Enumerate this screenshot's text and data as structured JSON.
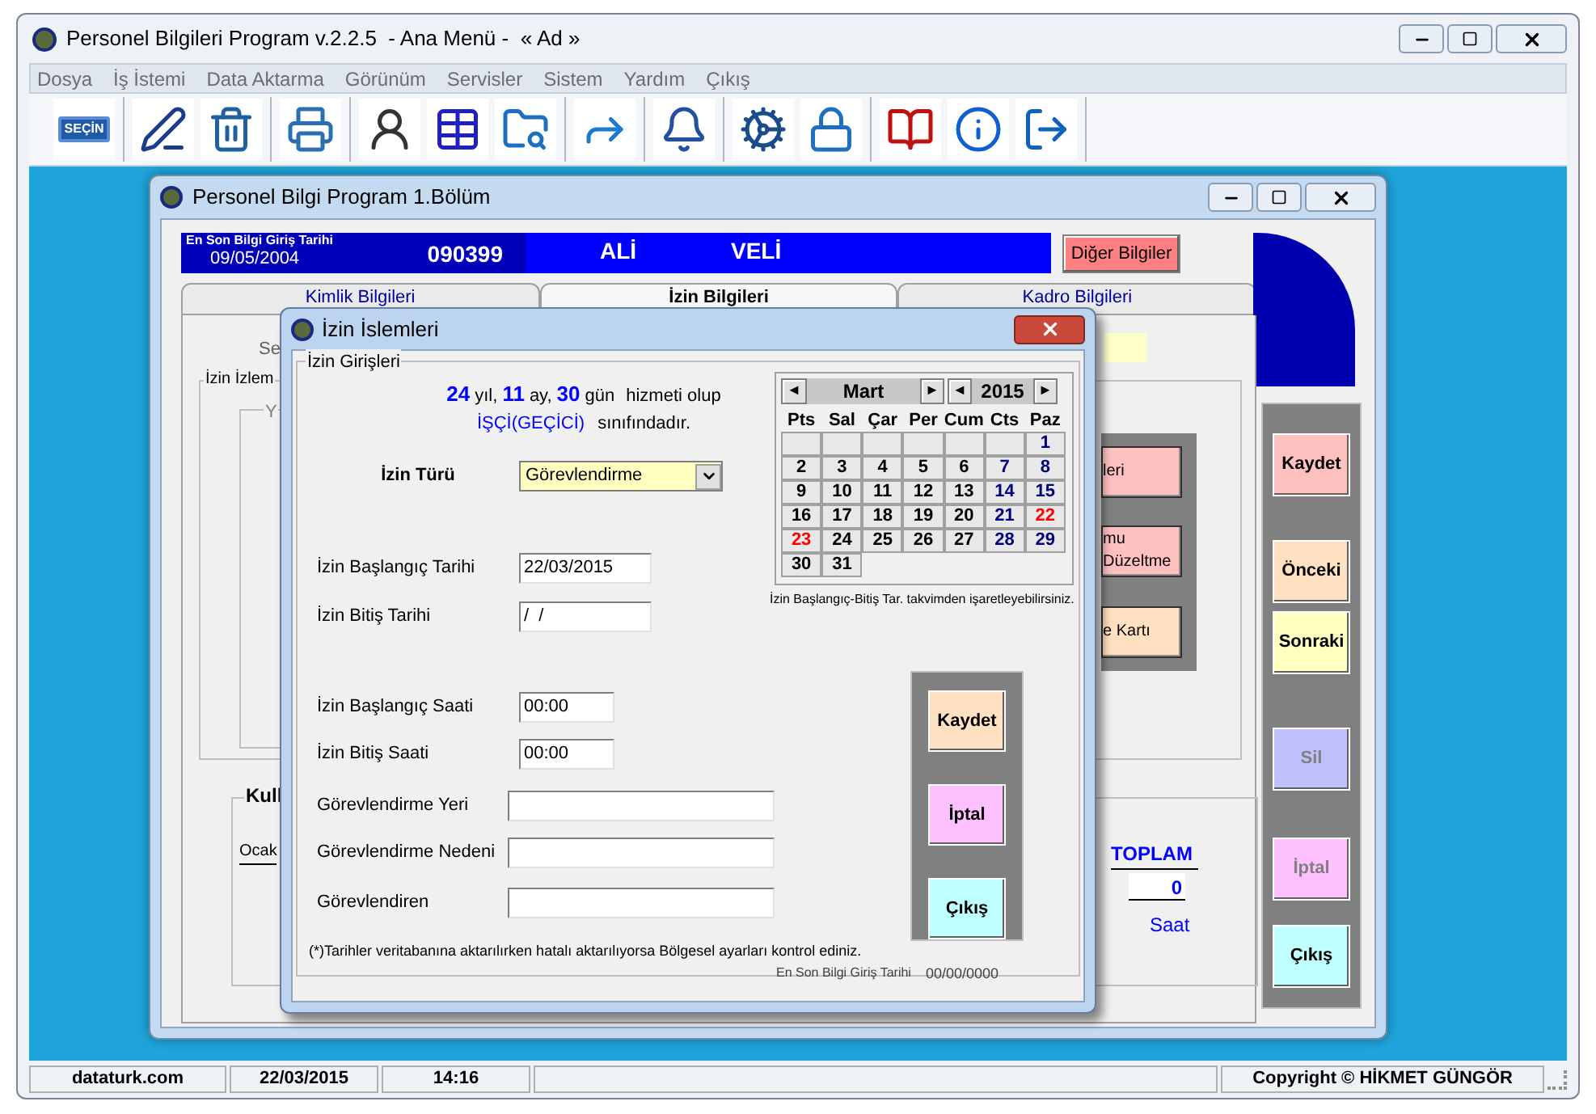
{
  "window": {
    "title": "Personel Bilgileri Program v.2.2.5  - Ana Menü -  « Ad »"
  },
  "menu": [
    {
      "label": "Dosya"
    },
    {
      "label": "İş İstemi"
    },
    {
      "label": "Data Aktarma"
    },
    {
      "label": "Görünüm"
    },
    {
      "label": "Servisler"
    },
    {
      "label": "Sistem"
    },
    {
      "label": "Yardım"
    },
    {
      "label": "Çıkış"
    }
  ],
  "toolbar": {
    "book_label": "SEÇİN"
  },
  "form_window": {
    "title": "Personel Bilgi Program 1.Bölüm",
    "header": {
      "date_caption": "En Son Bilgi Giriş Tarihi",
      "date": "09/05/2004",
      "number": "090399",
      "first_name": "ALİ",
      "last_name": "VELİ"
    },
    "other_info_button": {
      "label": "Diğer Bilgiler"
    },
    "tabs": [
      {
        "label": "Kimlik Bilgileri",
        "selected": false
      },
      {
        "label": "İzin Bilgileri",
        "selected": true
      },
      {
        "label": "Kadro Bilgileri",
        "selected": false
      }
    ],
    "panel": {
      "field_label": "Se",
      "group_title": "İzin İzlem",
      "inner_group_title": "Y",
      "side_buttons": [
        {
          "label": "leri",
          "color": "#ffc0c0"
        },
        {
          "label": "mu\nDüzeltme",
          "color": "#ffc0c0"
        },
        {
          "label": "e Kartı",
          "color": "#ffe0c0"
        }
      ],
      "usage_group": {
        "title": "Kull",
        "month": "Ocak",
        "total_caption": "TOPLAM",
        "total": "0",
        "unit": "Saat"
      }
    },
    "action_buttons": [
      {
        "label": "Kaydet",
        "color": "#ffc0c0",
        "disabled": false
      },
      {
        "label": "Önceki",
        "color": "#ffe0c0",
        "disabled": false
      },
      {
        "label": "Sonraki",
        "color": "#ffffc0",
        "disabled": false
      },
      {
        "label": "Sil",
        "color": "#c0c0ff",
        "disabled": true
      },
      {
        "label": "İptal",
        "color": "#ffc0ff",
        "disabled": true
      },
      {
        "label": "Çıkış",
        "color": "#c0ffff",
        "disabled": false
      }
    ]
  },
  "dialog": {
    "title": "İzin İslemleri",
    "group_title": "İzin Girişleri",
    "service": {
      "years": "24",
      "years_unit": "yıl,",
      "months": "11",
      "months_unit": "ay,",
      "days": "30",
      "days_unit": "gün",
      "tail": "hizmeti olup"
    },
    "staff_class": {
      "name": "İŞÇİ(GEÇİCİ)",
      "tail": "sınıfındadır."
    },
    "fields": [
      {
        "kind": "select",
        "label": "İzin Türü",
        "value": "Görevlendirme"
      },
      {
        "kind": "date",
        "label": "İzin Başlangıç Tarihi",
        "value": "22/03/2015"
      },
      {
        "kind": "date",
        "label": "İzin Bitiş Tarihi",
        "value": "/  /"
      },
      {
        "kind": "time",
        "label": "İzin Başlangıç Saati",
        "value": "00:00"
      },
      {
        "kind": "time",
        "label": "İzin Bitiş Saati",
        "value": "00:00"
      },
      {
        "kind": "text",
        "label": "Görevlendirme Yeri"
      },
      {
        "kind": "text",
        "label": "Görevlendirme Nedeni"
      },
      {
        "kind": "text",
        "label": "Görevlendiren"
      }
    ],
    "calendar": {
      "prev_month": "◄",
      "month": "Mart",
      "next_month": "►",
      "prev_year": "◄",
      "year": "2015",
      "next_year": "►",
      "weekdays": [
        "Pts",
        "Sal",
        "Çar",
        "Per",
        "Cum",
        "Cts",
        "Paz"
      ],
      "weeks": [
        {
          "right_aligned": true,
          "days": [
            {
              "day": "1",
              "color": "#000080"
            }
          ]
        },
        {
          "days": [
            {
              "day": "2",
              "color": "#000000"
            },
            {
              "day": "3",
              "color": "#000000"
            },
            {
              "day": "4",
              "color": "#000000"
            },
            {
              "day": "5",
              "color": "#000000"
            },
            {
              "day": "6",
              "color": "#000000"
            },
            {
              "day": "7",
              "color": "#000080"
            },
            {
              "day": "8",
              "color": "#000080"
            }
          ]
        },
        {
          "days": [
            {
              "day": "9",
              "color": "#000000"
            },
            {
              "day": "10",
              "color": "#000000"
            },
            {
              "day": "11",
              "color": "#000000"
            },
            {
              "day": "12",
              "color": "#000000"
            },
            {
              "day": "13",
              "color": "#000000"
            },
            {
              "day": "14",
              "color": "#000080"
            },
            {
              "day": "15",
              "color": "#000080"
            }
          ]
        },
        {
          "days": [
            {
              "day": "16",
              "color": "#000000"
            },
            {
              "day": "17",
              "color": "#000000"
            },
            {
              "day": "18",
              "color": "#000000"
            },
            {
              "day": "19",
              "color": "#000000"
            },
            {
              "day": "20",
              "color": "#000000"
            },
            {
              "day": "21",
              "color": "#000080"
            },
            {
              "day": "22",
              "color": "#ff0000"
            }
          ]
        },
        {
          "days": [
            {
              "day": "23",
              "color": "#ff0000"
            },
            {
              "day": "24",
              "color": "#000000"
            },
            {
              "day": "25",
              "color": "#000000"
            },
            {
              "day": "26",
              "color": "#000000"
            },
            {
              "day": "27",
              "color": "#000000"
            },
            {
              "day": "28",
              "color": "#000080"
            },
            {
              "day": "29",
              "color": "#000080"
            }
          ]
        },
        {
          "days": [
            {
              "day": "30",
              "color": "#000000"
            },
            {
              "day": "31",
              "color": "#000000"
            }
          ]
        }
      ]
    },
    "calendar_hint": "İzin Başlangıç-Bitiş Tar. takvimden işaretleyebilirsiniz.",
    "buttons": [
      {
        "label": "Kaydet",
        "color": "#ffe0c0"
      },
      {
        "label": "İptal",
        "color": "#ffc0ff"
      },
      {
        "label": "Çıkış",
        "color": "#c0ffff"
      }
    ],
    "note": "(*)Tarihler veritabanına aktarılırken hatalı aktarılıyorsa Bölgesel ayarları kontrol ediniz.",
    "last_entry_caption": "En Son Bilgi Giriş Tarihi",
    "last_entry_date": "00/00/0000"
  },
  "status_bar": [
    {
      "text": "dataturk.com"
    },
    {
      "text": "22/03/2015"
    },
    {
      "text": "14:16"
    },
    {
      "text": "Copyright © HİKMET GÜNGÖR"
    }
  ]
}
